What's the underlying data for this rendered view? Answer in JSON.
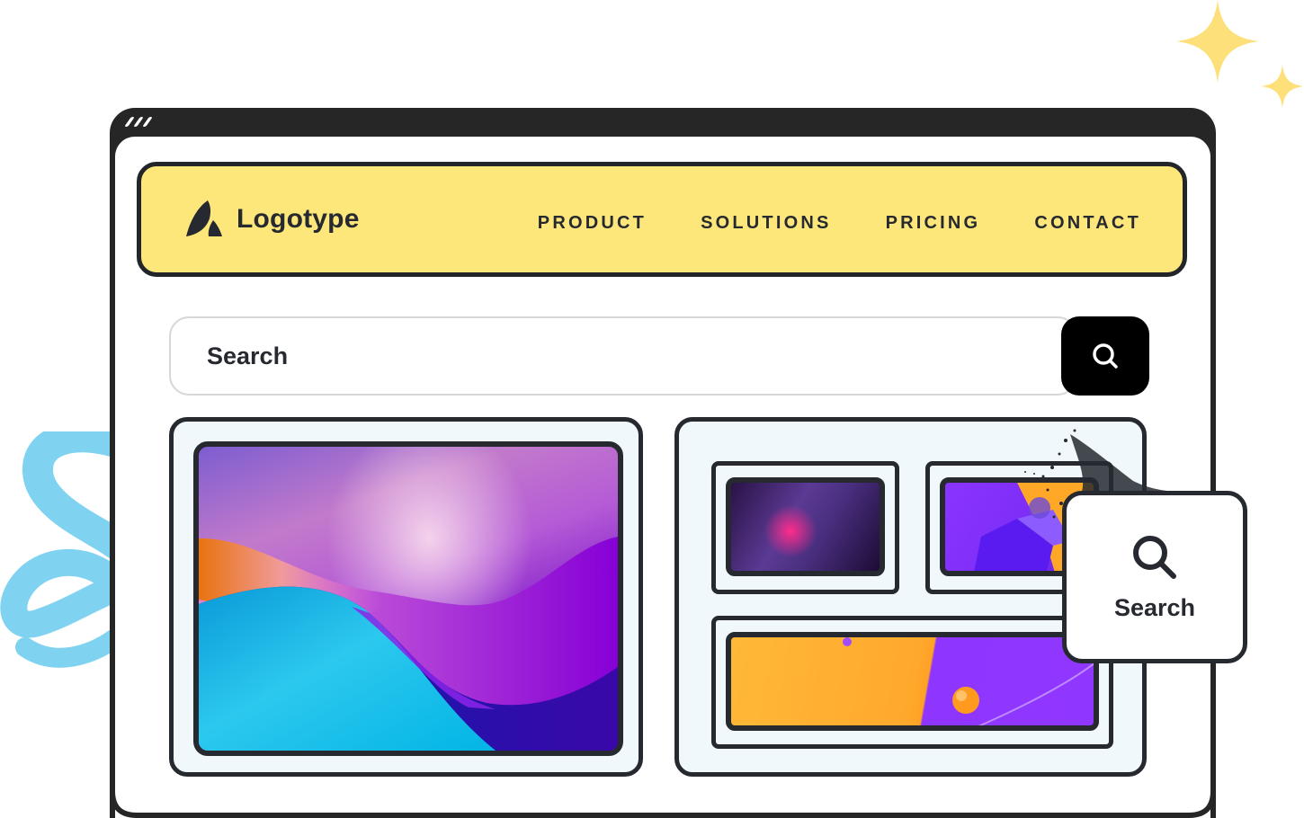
{
  "decorations": {
    "sparkle_color": "#fde07a",
    "squiggle_color": "#7fd3f0"
  },
  "window": {
    "frame_color": "#262626"
  },
  "navbar": {
    "background": "#fee77a",
    "logo": {
      "icon": "logo-mark-icon",
      "text": "Logotype"
    },
    "links": [
      {
        "label": "PRODUCT"
      },
      {
        "label": "SOLUTIONS"
      },
      {
        "label": "PRICING"
      },
      {
        "label": "CONTACT"
      }
    ]
  },
  "search": {
    "placeholder": "Search",
    "value": "",
    "button_icon": "search-icon"
  },
  "gallery": {
    "main_image": "gradient-wave-wallpaper",
    "thumbnails": [
      {
        "name": "dark-purple-pink-abstract"
      },
      {
        "name": "violet-orange-3d-abstract"
      },
      {
        "name": "orange-violet-sphere-banner"
      }
    ]
  },
  "floating_card": {
    "icon": "search-icon",
    "label": "Search"
  }
}
